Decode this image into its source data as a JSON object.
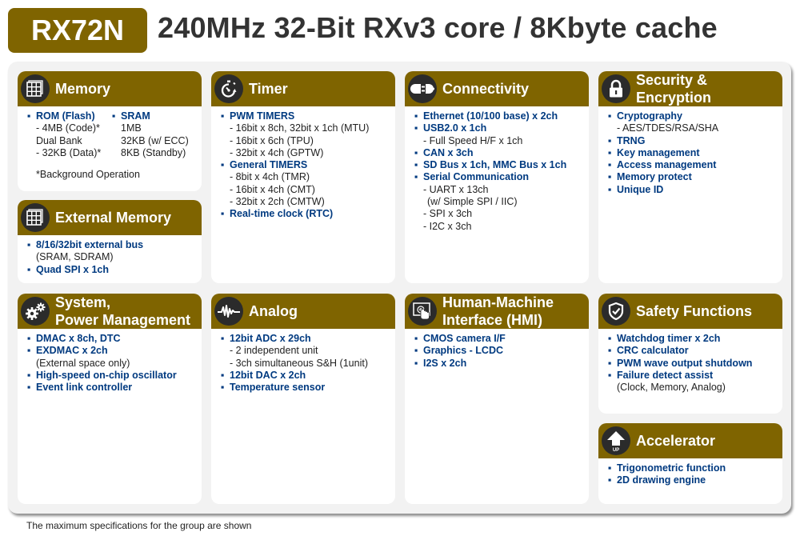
{
  "header": {
    "badge": "RX72N",
    "title": "240MHz 32-Bit RXv3 core / 8Kbyte cache"
  },
  "footer_note": "The maximum specifications for the group are shown",
  "colors": {
    "accent": "#7f6400",
    "bullet_text": "#003a80",
    "icon_bg": "#2b2b2b"
  },
  "cards": {
    "memory": {
      "title": "Memory",
      "icon": "memory-grid-icon",
      "left": [
        {
          "type": "bullet",
          "text": "ROM (Flash)"
        },
        {
          "type": "sub",
          "text": "- 4MB (Code)*"
        },
        {
          "type": "sub",
          "text": "Dual Bank"
        },
        {
          "type": "sub",
          "text": "- 32KB (Data)*"
        }
      ],
      "right": [
        {
          "type": "bullet",
          "text": "SRAM"
        },
        {
          "type": "sub",
          "text": "1MB"
        },
        {
          "type": "sub",
          "text": "32KB (w/ ECC)"
        },
        {
          "type": "sub",
          "text": "8KB (Standby)"
        }
      ],
      "footnote": "*Background Operation"
    },
    "external_memory": {
      "title": "External Memory",
      "icon": "memory-grid-icon",
      "items": [
        {
          "type": "bullet",
          "text": "8/16/32bit external bus"
        },
        {
          "type": "sub",
          "text": "(SRAM, SDRAM)"
        },
        {
          "type": "bullet",
          "text": "Quad SPI x 1ch"
        }
      ]
    },
    "system": {
      "title_line1": "System,",
      "title_line2": "Power Management",
      "icon": "gears-icon",
      "items": [
        {
          "type": "bullet",
          "text": "DMAC x 8ch, DTC"
        },
        {
          "type": "bullet",
          "text": "EXDMAC x 2ch"
        },
        {
          "type": "sub",
          "text": "(External space only)"
        },
        {
          "type": "bullet",
          "text": "High-speed on-chip oscillator"
        },
        {
          "type": "bullet",
          "text": "Event link controller"
        }
      ]
    },
    "timer": {
      "title": "Timer",
      "icon": "stopwatch-icon",
      "items": [
        {
          "type": "bullet",
          "text": "PWM TIMERS"
        },
        {
          "type": "sub",
          "text": "- 16bit x 8ch, 32bit x 1ch (MTU)"
        },
        {
          "type": "sub",
          "text": "- 16bit x 6ch (TPU)"
        },
        {
          "type": "sub",
          "text": "- 32bit x 4ch (GPTW)"
        },
        {
          "type": "bullet",
          "text": "General TIMERS"
        },
        {
          "type": "sub",
          "text": "- 8bit x 4ch (TMR)"
        },
        {
          "type": "sub",
          "text": "- 16bit x 4ch (CMT)"
        },
        {
          "type": "sub",
          "text": "- 32bit x 2ch (CMTW)"
        },
        {
          "type": "bullet",
          "text": "Real-time clock (RTC)"
        }
      ]
    },
    "analog": {
      "title": "Analog",
      "icon": "waveform-icon",
      "items": [
        {
          "type": "bullet",
          "text": "12bit  ADC x 29ch"
        },
        {
          "type": "sub",
          "text": "- 2 independent unit"
        },
        {
          "type": "sub",
          "text": "- 3ch simultaneous S&H (1unit)"
        },
        {
          "type": "bullet",
          "text": "12bit DAC x 2ch"
        },
        {
          "type": "bullet",
          "text": "Temperature sensor"
        }
      ]
    },
    "connectivity": {
      "title": "Connectivity",
      "icon": "plug-icon",
      "items": [
        {
          "type": "bullet",
          "text": "Ethernet (10/100 base) x 2ch"
        },
        {
          "type": "bullet",
          "text": "USB2.0 x 1ch"
        },
        {
          "type": "sub",
          "text": "- Full Speed H/F x 1ch"
        },
        {
          "type": "bullet",
          "text": "CAN x 3ch"
        },
        {
          "type": "bullet",
          "text": "SD Bus x 1ch, MMC Bus x 1ch"
        },
        {
          "type": "bullet",
          "text": "Serial Communication"
        },
        {
          "type": "sub",
          "text": "- UART x 13ch"
        },
        {
          "type": "sub",
          "text": "  (w/ Simple SPI / IIC)"
        },
        {
          "type": "sub",
          "text": "- SPI x 3ch"
        },
        {
          "type": "sub",
          "text": "- I2C x 3ch"
        }
      ]
    },
    "hmi": {
      "title_line1": "Human-Machine",
      "title_line2": "Interface (HMI)",
      "icon": "touchscreen-icon",
      "items": [
        {
          "type": "bullet",
          "text": "CMOS camera I/F"
        },
        {
          "type": "bullet",
          "text": "Graphics - LCDC"
        },
        {
          "type": "bullet",
          "text": "I2S x 2ch"
        }
      ]
    },
    "security": {
      "title_line1": "Security &",
      "title_line2": "Encryption",
      "icon": "padlock-icon",
      "items": [
        {
          "type": "bullet",
          "text": "Cryptography"
        },
        {
          "type": "sub",
          "text": "- AES/TDES/RSA/SHA"
        },
        {
          "type": "bullet",
          "text": "TRNG"
        },
        {
          "type": "bullet",
          "text": "Key management"
        },
        {
          "type": "bullet",
          "text": "Access management"
        },
        {
          "type": "bullet",
          "text": "Memory protect"
        },
        {
          "type": "bullet",
          "text": "Unique ID"
        }
      ]
    },
    "safety": {
      "title": "Safety Functions",
      "icon": "shield-check-icon",
      "items": [
        {
          "type": "bullet",
          "text": "Watchdog timer x 2ch"
        },
        {
          "type": "bullet",
          "text": "CRC calculator"
        },
        {
          "type": "bullet",
          "text": "PWM wave output shutdown"
        },
        {
          "type": "bullet",
          "text": "Failure detect assist"
        },
        {
          "type": "sub",
          "text": "(Clock, Memory, Analog)"
        }
      ]
    },
    "accelerator": {
      "title": "Accelerator",
      "icon": "up-arrow-icon",
      "icon_label": "UP",
      "items": [
        {
          "type": "bullet",
          "text": "Trigonometric function"
        },
        {
          "type": "bullet",
          "text": "2D drawing engine"
        }
      ]
    }
  }
}
